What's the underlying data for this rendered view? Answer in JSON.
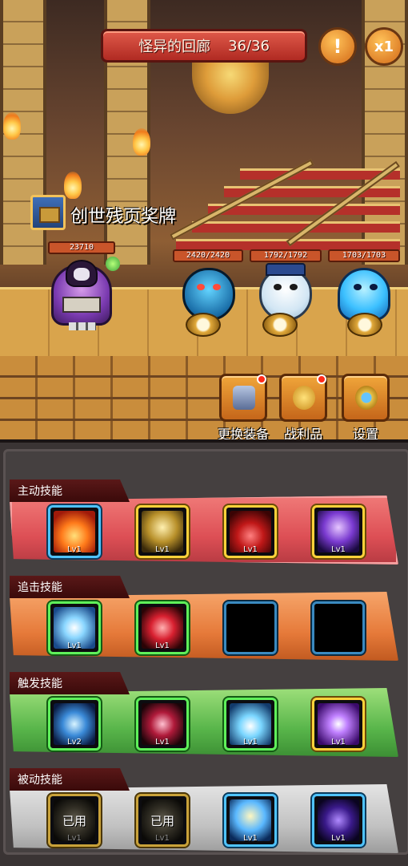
{
  "stage": {
    "name": "怪异的回廊",
    "progress": "36/36"
  },
  "top_buttons": {
    "alert_glyph": "!",
    "speed_label": "x1"
  },
  "relic": {
    "name": "创世残页奖牌"
  },
  "hero": {
    "hp": "23710"
  },
  "monsters": [
    {
      "hp": "2420/2420"
    },
    {
      "hp": "1792/1792"
    },
    {
      "hp": "1703/1703"
    }
  ],
  "menu": {
    "equip_label": "更换装备",
    "loot_label": "战利品",
    "settings_label": "设置"
  },
  "skills": {
    "active": {
      "title": "主动技能",
      "slots": [
        {
          "icon": "fire-skill-icon",
          "level": "Lv1"
        },
        {
          "icon": "storm-skill-icon",
          "level": "Lv1"
        },
        {
          "icon": "blood-skill-icon",
          "level": "Lv1"
        },
        {
          "icon": "moon-skill-icon",
          "level": "Lv1"
        }
      ]
    },
    "chase": {
      "title": "追击技能",
      "slots": [
        {
          "icon": "ice-crystal-skill-icon",
          "level": "Lv1"
        },
        {
          "icon": "claw-skill-icon",
          "level": "Lv1"
        },
        {
          "icon": "empty-slot",
          "level": ""
        },
        {
          "icon": "empty-slot",
          "level": ""
        }
      ]
    },
    "trigger": {
      "title": "触发技能",
      "slots": [
        {
          "icon": "wind-dash-skill-icon",
          "level": "Lv2"
        },
        {
          "icon": "slash-skill-icon",
          "level": "Lv1"
        },
        {
          "icon": "frost-burst-skill-icon",
          "level": "Lv1"
        },
        {
          "icon": "arcane-nova-skill-icon",
          "level": "Lv1"
        }
      ]
    },
    "passive": {
      "title": "被动技能",
      "slots": [
        {
          "icon": "rune-skill-icon",
          "level": "Lv1",
          "status": "已用"
        },
        {
          "icon": "rune-skill-icon",
          "level": "Lv1",
          "status": "已用"
        },
        {
          "icon": "angel-skill-icon",
          "level": "Lv1",
          "status": ""
        },
        {
          "icon": "shadow-skill-icon",
          "level": "Lv1",
          "status": ""
        }
      ]
    }
  }
}
